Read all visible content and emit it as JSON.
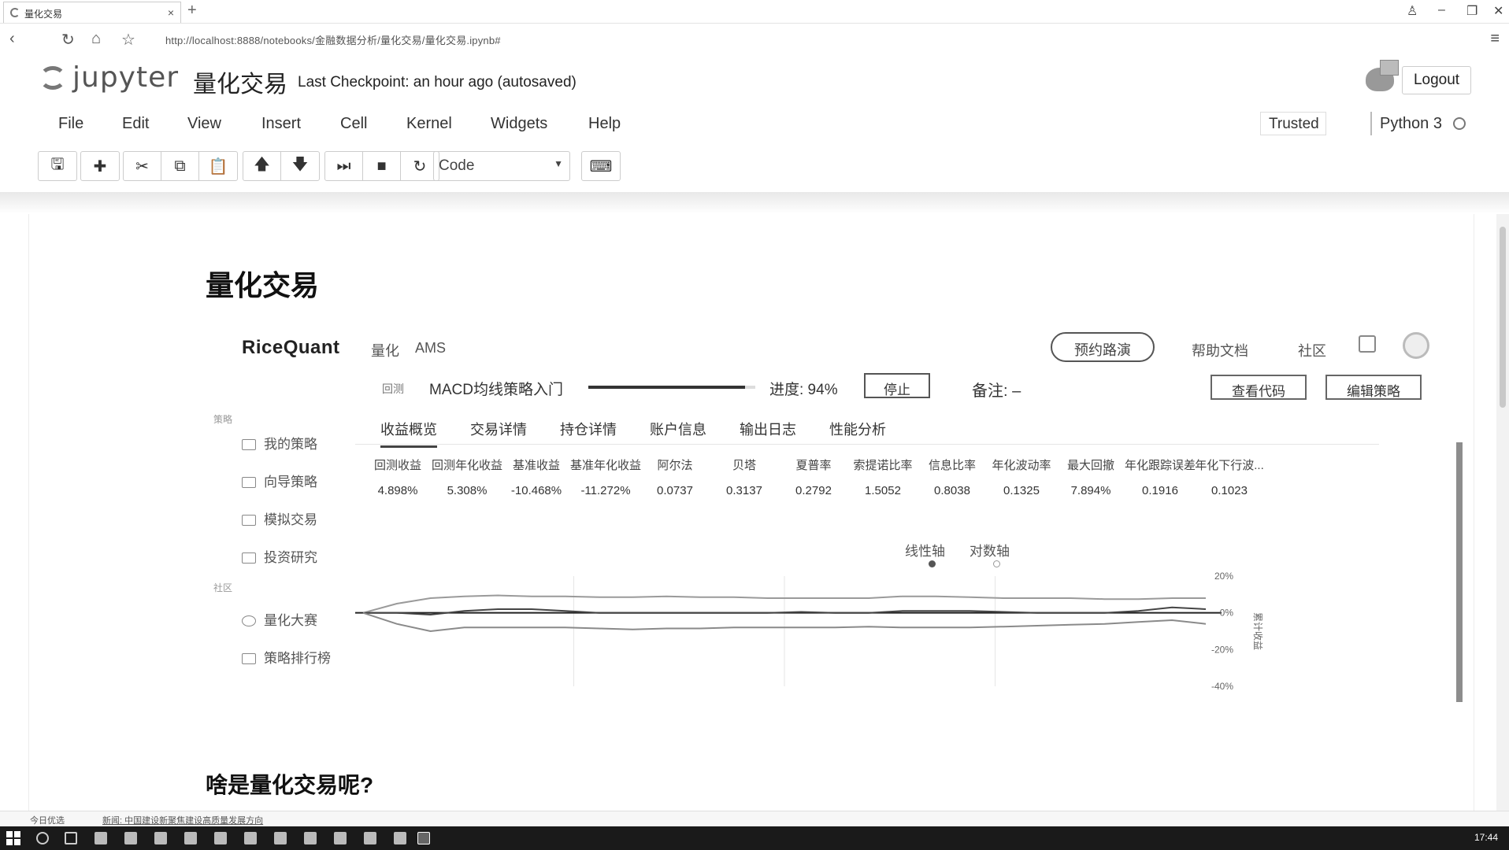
{
  "browser": {
    "tab_title": "量化交易",
    "url": "http://localhost:8888/notebooks/金融数据分析/量化交易/量化交易.ipynb#"
  },
  "jupyter": {
    "logo_text": "jupyter",
    "notebook_name": "量化交易",
    "checkpoint": "Last Checkpoint: an hour ago (autosaved)",
    "logout": "Logout",
    "menu": [
      "File",
      "Edit",
      "View",
      "Insert",
      "Cell",
      "Kernel",
      "Widgets",
      "Help"
    ],
    "trusted": "Trusted",
    "kernel": "Python 3",
    "cell_type": "Code"
  },
  "notebook": {
    "heading1": "量化交易",
    "heading2": "啥是量化交易呢?"
  },
  "ricequant": {
    "logo": "RiceQuant",
    "nav": [
      "量化",
      "AMS"
    ],
    "pill_button": "预约路演",
    "help": "帮助文档",
    "community": "社区",
    "strategy_label": "回测",
    "strategy_name": "MACD均线策略入门",
    "progress_text": "进度: 94%",
    "progress_fraction": 0.94,
    "stop_button": "停止",
    "note": "备注: –",
    "view_code": "查看代码",
    "edit_strategy": "编辑策略",
    "sidebar": {
      "section_top": "策略",
      "items_top": [
        "我的策略",
        "向导策略",
        "模拟交易",
        "投资研究"
      ],
      "section_bottom": "社区",
      "items_bottom": [
        "量化大赛",
        "策略排行榜"
      ]
    },
    "subtabs": [
      "收益概览",
      "交易详情",
      "持仓详情",
      "账户信息",
      "输出日志",
      "性能分析"
    ],
    "metrics": [
      {
        "k": "回测收益",
        "v": "4.898%"
      },
      {
        "k": "回测年化收益",
        "v": "5.308%"
      },
      {
        "k": "基准收益",
        "v": "-10.468%"
      },
      {
        "k": "基准年化收益",
        "v": "-11.272%"
      },
      {
        "k": "阿尔法",
        "v": "0.0737"
      },
      {
        "k": "贝塔",
        "v": "0.3137"
      },
      {
        "k": "夏普率",
        "v": "0.2792"
      },
      {
        "k": "索提诺比率",
        "v": "1.5052"
      },
      {
        "k": "信息比率",
        "v": "0.8038"
      },
      {
        "k": "年化波动率",
        "v": "0.1325"
      },
      {
        "k": "最大回撤",
        "v": "7.894%"
      },
      {
        "k": "年化跟踪误差",
        "v": "0.1916"
      },
      {
        "k": "年化下行波...",
        "v": "0.1023"
      }
    ],
    "axis_options": [
      "线性轴",
      "对数轴"
    ],
    "y_axis_label": "累计收益"
  },
  "chart_data": {
    "type": "line",
    "y_ticks": [
      "20%",
      "0%",
      "-20%",
      "-40%"
    ],
    "ylim": [
      -40,
      20
    ],
    "series": [
      {
        "values": [
          0,
          5,
          8,
          9,
          9.5,
          9,
          9,
          8.5,
          8.5,
          9,
          8.5,
          8.5,
          8,
          8,
          8,
          8,
          9,
          9,
          8.5,
          8,
          8,
          8,
          7.5,
          7.5,
          8,
          8
        ]
      },
      {
        "values": [
          0,
          0,
          -1,
          1,
          2,
          2,
          1,
          0,
          0,
          0,
          0,
          0,
          0,
          0.5,
          0,
          0,
          1,
          1,
          1,
          0.5,
          0,
          0,
          0,
          1,
          3,
          2
        ]
      },
      {
        "values": [
          0,
          -6,
          -10,
          -8,
          -8,
          -8,
          -8,
          -8.5,
          -9,
          -8.5,
          -8.5,
          -8,
          -8,
          -8,
          -8,
          -7.5,
          -8,
          -8,
          -8,
          -7.5,
          -7,
          -6.5,
          -6,
          -5,
          -4,
          -6
        ]
      }
    ]
  },
  "statusbar": {
    "left": "今日优选",
    "news": "新闻: 中国建设新聚焦建设高质量发展方向"
  },
  "clock": "17:44"
}
